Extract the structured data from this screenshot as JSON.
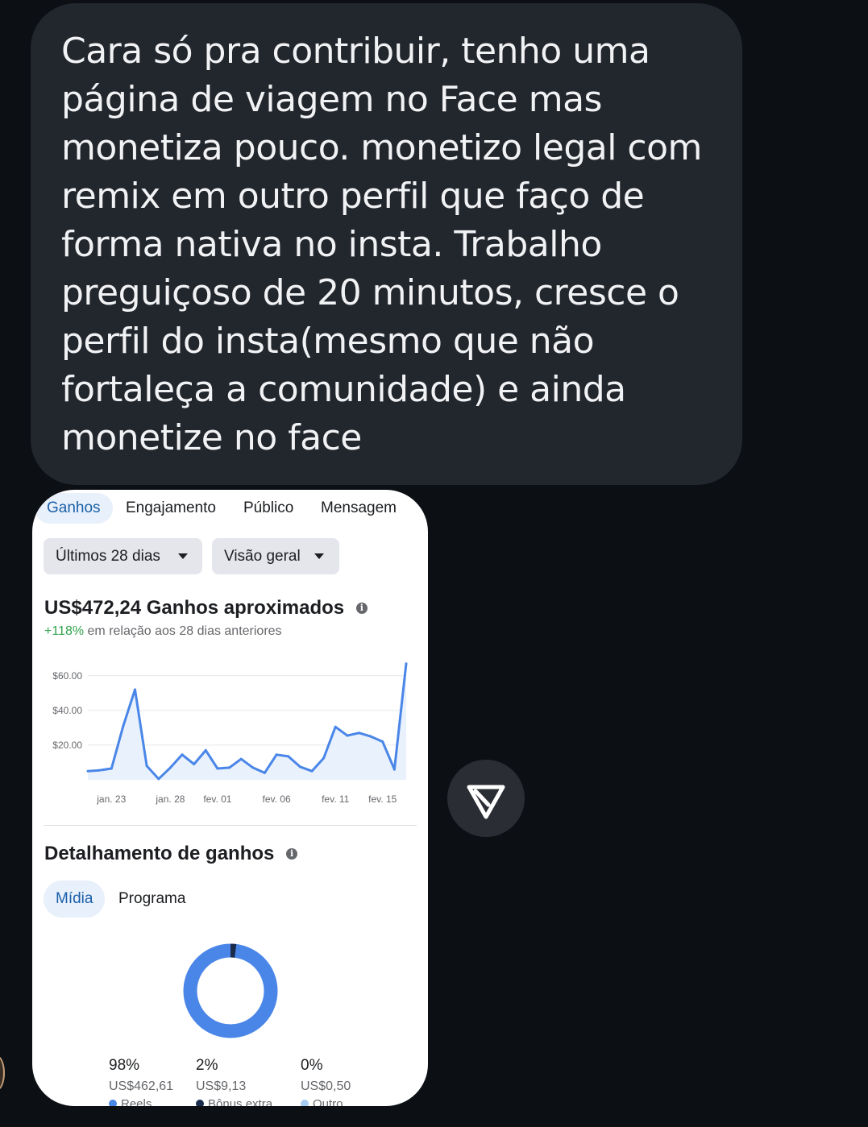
{
  "message": {
    "text": "Cara só pra contribuir, tenho uma página de viagem no Face mas monetiza pouco. monetizo legal com remix em outro perfil que faço de forma nativa no insta. Trabalho preguiçoso de 20 minutos, cresce o perfil do insta(mesmo que não fortaleça a comunidade) e ainda monetize no face"
  },
  "card": {
    "tabs": [
      "Ganhos",
      "Engajamento",
      "Público",
      "Mensagem"
    ],
    "filters": {
      "period": "Últimos 28 dias",
      "view": "Visão geral"
    },
    "earnings": {
      "amount": "US$472,24",
      "label": "Ganhos aproximados",
      "change": "+118%",
      "change_text": "em relação aos 28 dias anteriores"
    },
    "breakdown": {
      "title": "Detalhamento de ganhos",
      "tabs": [
        "Mídia",
        "Programa"
      ],
      "items": [
        {
          "pct": "98%",
          "amount": "US$462,61",
          "label": "Reels",
          "color": "#4a86e8"
        },
        {
          "pct": "2%",
          "amount": "US$9,13",
          "label": "Bônus extra",
          "color": "#1a2b4c"
        },
        {
          "pct": "0%",
          "amount": "US$0,50",
          "label": "Outro",
          "color": "#a8cdf5"
        }
      ]
    }
  },
  "chart_data": {
    "type": "area",
    "x_tick_labels": [
      "jan. 23",
      "jan. 28",
      "fev. 01",
      "fev. 06",
      "fev. 11",
      "fev. 15"
    ],
    "y_tick_labels": [
      "$60.00",
      "$40.00",
      "$20.00"
    ],
    "ylim": [
      0,
      65
    ],
    "grid": true,
    "color": "#4a86e8",
    "x": [
      "jan. 21",
      "jan. 22",
      "jan. 23",
      "jan. 24",
      "jan. 25",
      "jan. 26",
      "jan. 27",
      "jan. 28",
      "jan. 29",
      "jan. 30",
      "jan. 31",
      "fev. 01",
      "fev. 02",
      "fev. 03",
      "fev. 04",
      "fev. 05",
      "fev. 06",
      "fev. 07",
      "fev. 08",
      "fev. 09",
      "fev. 10",
      "fev. 11",
      "fev. 12",
      "fev. 13",
      "fev. 14",
      "fev. 15",
      "fev. 16",
      "fev. 17"
    ],
    "values": [
      5,
      5.5,
      6.5,
      31,
      52,
      8,
      0.5,
      7,
      14.5,
      9,
      17,
      6.5,
      7,
      12,
      7,
      4,
      14.5,
      13.5,
      7.5,
      5,
      12.5,
      30.5,
      25.5,
      27,
      25,
      22,
      6,
      67
    ]
  },
  "send_button": {
    "icon": "send-icon"
  }
}
